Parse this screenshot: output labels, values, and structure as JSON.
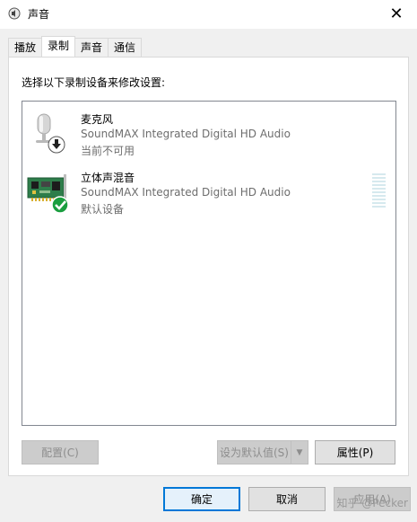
{
  "window": {
    "title": "声音",
    "close_icon": "close-icon",
    "speaker_icon": "speaker-icon"
  },
  "tabs": [
    {
      "label": "播放",
      "active": false
    },
    {
      "label": "录制",
      "active": true
    },
    {
      "label": "声音",
      "active": false
    },
    {
      "label": "通信",
      "active": false
    }
  ],
  "panel": {
    "instruction": "选择以下录制设备来修改设置:"
  },
  "devices": [
    {
      "name": "麦克风",
      "driver": "SoundMAX Integrated Digital HD Audio",
      "status": "当前不可用",
      "icon": "microphone-icon",
      "badge": "down-arrow-badge-icon"
    },
    {
      "name": "立体声混音",
      "driver": "SoundMAX Integrated Digital HD Audio",
      "status": "默认设备",
      "icon": "sound-card-icon",
      "badge": "checkmark-badge-icon"
    }
  ],
  "buttons": {
    "configure": "配置(C)",
    "set_default": "设为默认值(S)",
    "properties": "属性(P)",
    "ok": "确定",
    "cancel": "取消",
    "apply": "应用(A)"
  },
  "watermark": "知乎 @Pecker",
  "colors": {
    "accent": "#0078d7",
    "checkmark": "#1a9e3f",
    "level_meter": "#d6e9ee"
  }
}
